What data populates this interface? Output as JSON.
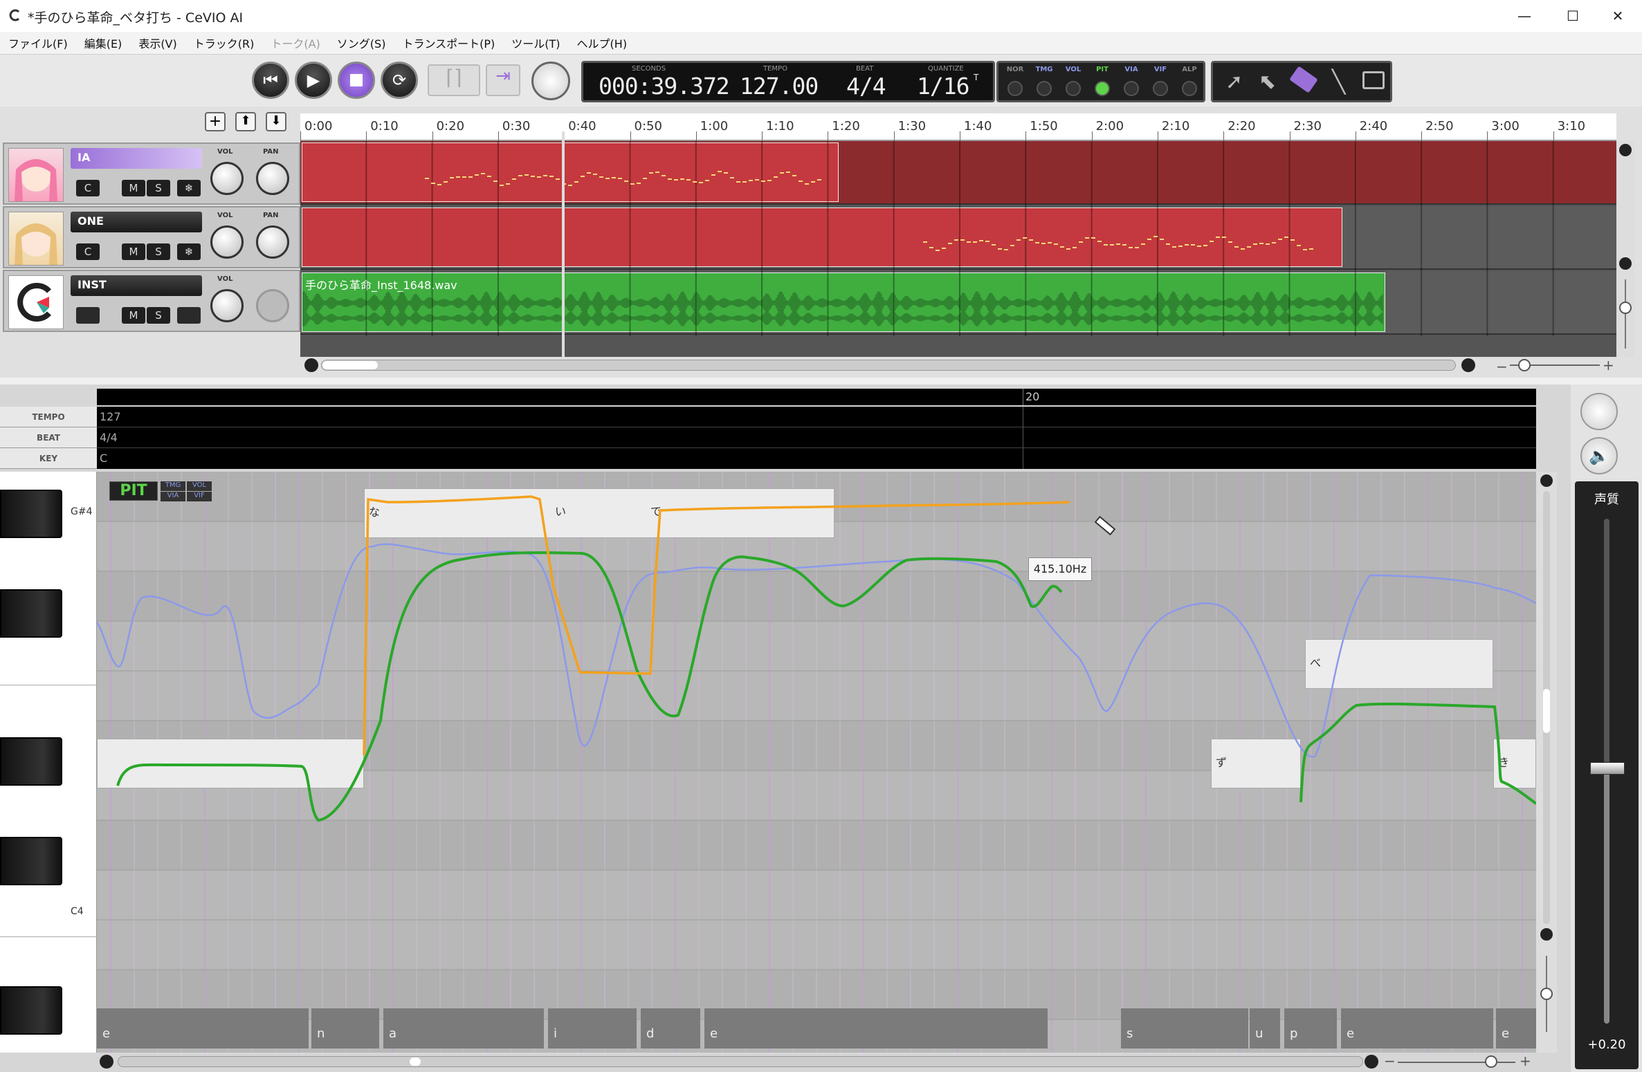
{
  "window": {
    "title": "*手のひら革命_ベタ打ち - CeVIO AI",
    "controls": {
      "minimize": "—",
      "maximize": "☐",
      "close": "✕"
    }
  },
  "menu": [
    "ファイル(F)",
    "編集(E)",
    "表示(V)",
    "トラック(R)",
    "トーク(A)",
    "ソング(S)",
    "トランスポート(P)",
    "ツール(T)",
    "ヘルプ(H)"
  ],
  "menu_disabled_index": 4,
  "transport": {
    "seconds_label": "SECONDS",
    "seconds": "000:39.372",
    "tempo_label": "TEMPO",
    "tempo": "127.00",
    "beat_label": "BEAT",
    "beat": "4/4",
    "quantize_label": "QUANTIZE",
    "quantize": "1/16",
    "quantize_sup": "T"
  },
  "param_modes": [
    "NOR",
    "TMG",
    "VOL",
    "PIT",
    "VIA",
    "VIF",
    "ALP"
  ],
  "param_active": "PIT",
  "timeline_ticks": [
    "0:00",
    "0:10",
    "0:20",
    "0:30",
    "0:40",
    "0:50",
    "1:00",
    "1:10",
    "1:20",
    "1:30",
    "1:40",
    "1:50",
    "2:00",
    "2:10",
    "2:20",
    "2:30",
    "2:40",
    "2:50",
    "3:00",
    "3:10"
  ],
  "tracks": [
    {
      "name": "IA",
      "buttons": [
        "C",
        "M",
        "S",
        "❄"
      ],
      "knobs": [
        "VOL",
        "PAN"
      ]
    },
    {
      "name": "ONE",
      "buttons": [
        "C",
        "M",
        "S",
        "❄"
      ],
      "knobs": [
        "VOL",
        "PAN"
      ]
    },
    {
      "name": "INST",
      "buttons": [
        "M",
        "S"
      ],
      "knobs": [
        "VOL"
      ],
      "clip": "手のひら革命_Inst_1648.wav"
    }
  ],
  "editor": {
    "measure": "20",
    "rows": {
      "tempo_label": "TEMPO",
      "tempo": "127",
      "beat_label": "BEAT",
      "beat": "4/4",
      "key_label": "KEY",
      "key": "C"
    },
    "key_labels": {
      "gs4": "G#4",
      "c4": "C4"
    },
    "mode_badge": "PIT",
    "mode_badges_small": [
      "TMG",
      "VOL",
      "VIA",
      "VIF"
    ],
    "notes": [
      {
        "lyric": "な"
      },
      {
        "lyric": "い"
      },
      {
        "lyric": "で"
      },
      {
        "lyric": "ず"
      },
      {
        "lyric": "べ"
      },
      {
        "lyric": "き"
      },
      {
        "lyric": ""
      }
    ],
    "phonemes": [
      "e",
      "n",
      "a",
      "i",
      "d",
      "e",
      "s",
      "u",
      "p",
      "e",
      "e"
    ],
    "tooltip": "415.10Hz"
  },
  "right_panel": {
    "label": "声質",
    "value": "+0.20"
  },
  "colors": {
    "accent_purple": "#8a5cd6",
    "track_red": "#c4393f",
    "track_green": "#3fae3f",
    "pitch_orange": "#f3a21d",
    "pitch_green": "#2aa82a",
    "pitch_blue": "#8c99ea"
  }
}
